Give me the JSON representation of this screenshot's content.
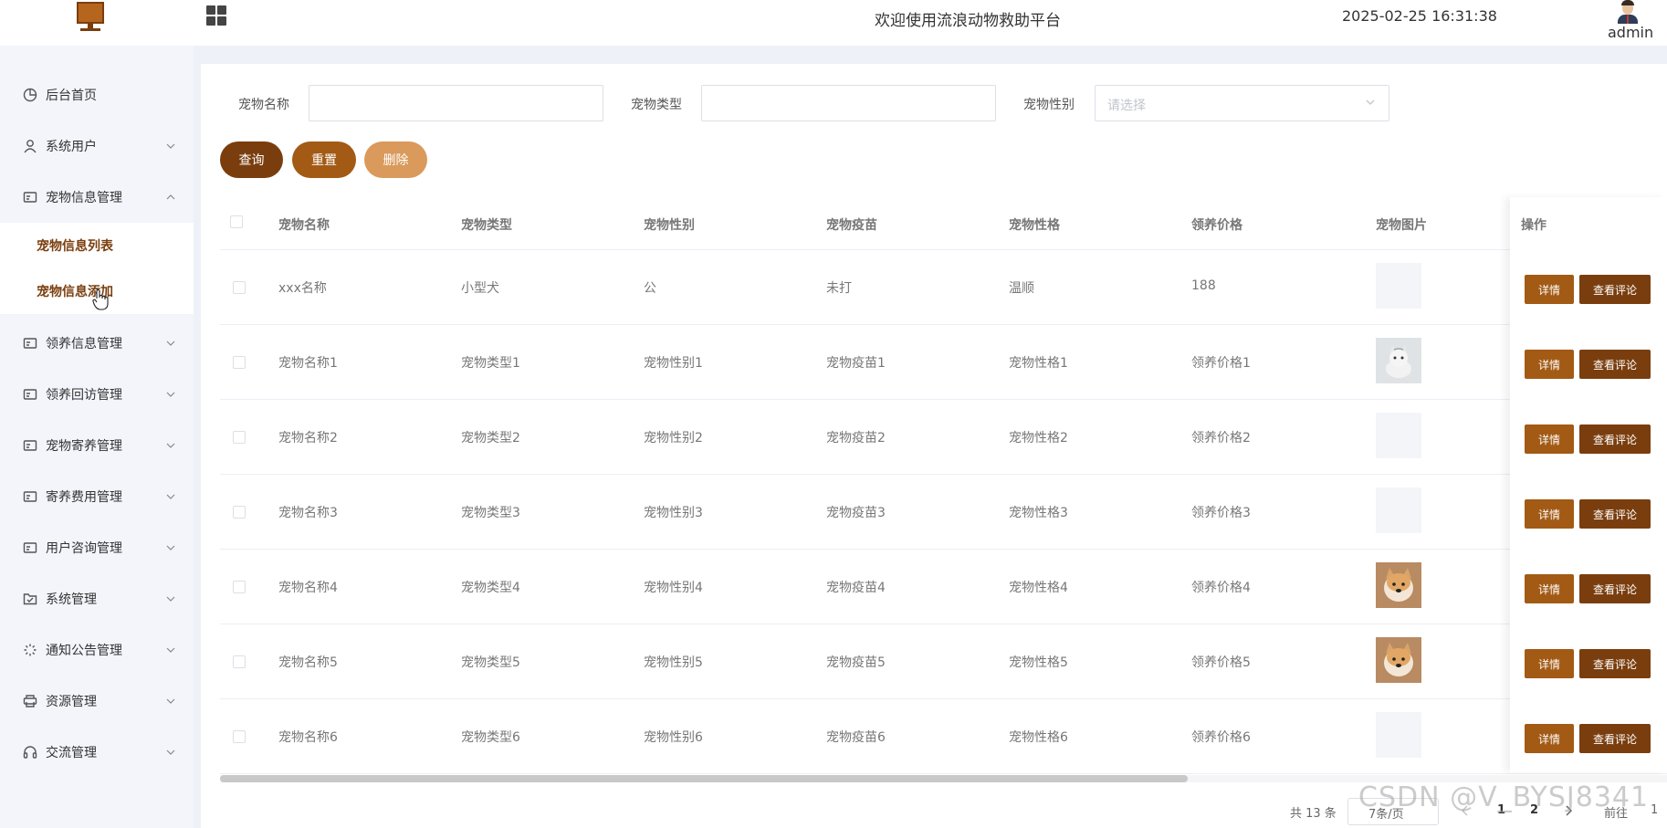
{
  "header": {
    "title": "欢迎使用流浪动物救助平台",
    "datetime": "2025-02-25 16:31:38",
    "user": "admin"
  },
  "sidebar": {
    "items": [
      {
        "label": "后台首页",
        "icon": "pie-chart-icon"
      },
      {
        "label": "系统用户",
        "icon": "user-icon"
      },
      {
        "label": "宠物信息管理",
        "icon": "card-icon"
      },
      {
        "label": "领养信息管理",
        "icon": "card-icon"
      },
      {
        "label": "领养回访管理",
        "icon": "card-icon"
      },
      {
        "label": "宠物寄养管理",
        "icon": "card-icon"
      },
      {
        "label": "寄养费用管理",
        "icon": "card-icon"
      },
      {
        "label": "用户咨询管理",
        "icon": "card-icon"
      },
      {
        "label": "系统管理",
        "icon": "folder-check-icon"
      },
      {
        "label": "通知公告管理",
        "icon": "loading-icon"
      },
      {
        "label": "资源管理",
        "icon": "printer-icon"
      },
      {
        "label": "交流管理",
        "icon": "headset-icon"
      }
    ],
    "submenu": [
      "宠物信息列表",
      "宠物信息添加"
    ]
  },
  "filters": {
    "name_label": "宠物名称",
    "type_label": "宠物类型",
    "gender_label": "宠物性别",
    "gender_placeholder": "请选择"
  },
  "buttons": {
    "query": "查询",
    "reset": "重置",
    "delete": "删除"
  },
  "table": {
    "columns": [
      "宠物名称",
      "宠物类型",
      "宠物性别",
      "宠物疫苗",
      "宠物性格",
      "领养价格",
      "宠物图片",
      "操作"
    ],
    "rows": [
      {
        "name": "xxx名称",
        "type": "小型犬",
        "gender": "公",
        "vaccine": "未打",
        "character": "温顺",
        "price": "188",
        "image": "none"
      },
      {
        "name": "宠物名称1",
        "type": "宠物类型1",
        "gender": "宠物性别1",
        "vaccine": "宠物疫苗1",
        "character": "宠物性格1",
        "price": "领养价格1",
        "image": "kitten"
      },
      {
        "name": "宠物名称2",
        "type": "宠物类型2",
        "gender": "宠物性别2",
        "vaccine": "宠物疫苗2",
        "character": "宠物性格2",
        "price": "领养价格2",
        "image": "none"
      },
      {
        "name": "宠物名称3",
        "type": "宠物类型3",
        "gender": "宠物性别3",
        "vaccine": "宠物疫苗3",
        "character": "宠物性格3",
        "price": "领养价格3",
        "image": "none"
      },
      {
        "name": "宠物名称4",
        "type": "宠物类型4",
        "gender": "宠物性别4",
        "vaccine": "宠物疫苗4",
        "character": "宠物性格4",
        "price": "领养价格4",
        "image": "dog"
      },
      {
        "name": "宠物名称5",
        "type": "宠物类型5",
        "gender": "宠物性别5",
        "vaccine": "宠物疫苗5",
        "character": "宠物性格5",
        "price": "领养价格5",
        "image": "dog"
      },
      {
        "name": "宠物名称6",
        "type": "宠物类型6",
        "gender": "宠物性别6",
        "vaccine": "宠物疫苗6",
        "character": "宠物性格6",
        "price": "领养价格6",
        "image": "none"
      }
    ],
    "detail_label": "详情",
    "comment_label": "查看评论"
  },
  "pagination": {
    "total": "共 13 条",
    "page_size": "7条/页",
    "pages": [
      "1",
      "2"
    ],
    "goto_label": "前往",
    "goto_value": "1"
  },
  "watermark": "CSDN @V_BYSJ8341",
  "colors": {
    "brand_dark": "#7a3e0e",
    "brand": "#a25a14",
    "brand_light": "#d99a5b",
    "sidebar_bg": "#f3f5fb"
  }
}
